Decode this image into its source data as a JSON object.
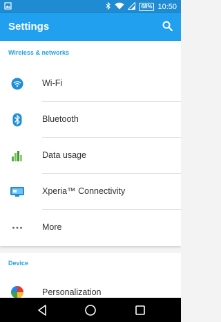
{
  "status_bar": {
    "battery": "68%",
    "time": "10:50"
  },
  "app_bar": {
    "title": "Settings"
  },
  "sections": [
    {
      "header": "Wireless & networks",
      "items": [
        {
          "label": "Wi-Fi",
          "icon": "wifi-icon"
        },
        {
          "label": "Bluetooth",
          "icon": "bluetooth-icon"
        },
        {
          "label": "Data usage",
          "icon": "data-usage-icon"
        },
        {
          "label": "Xperia™ Connectivity",
          "icon": "xperia-connectivity-icon"
        },
        {
          "label": "More",
          "icon": "more-icon"
        }
      ]
    },
    {
      "header": "Device",
      "items": [
        {
          "label": "Personalization",
          "icon": "personalization-icon"
        }
      ]
    }
  ],
  "colors": {
    "status_bar": "#1e8bd3",
    "app_bar": "#21a0f0",
    "section_header": "#1fa0e6",
    "icon_blue": "#1e8fd6"
  }
}
